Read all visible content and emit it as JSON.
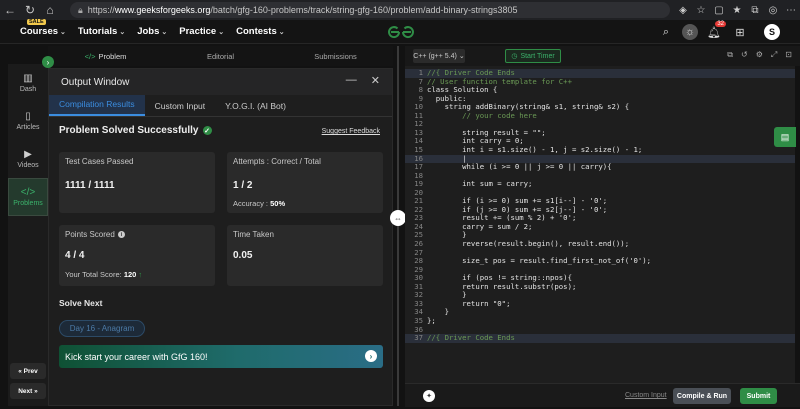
{
  "browser": {
    "url_prefix": "https://",
    "url_domain": "www.geeksforgeeks.org",
    "url_path": "/batch/gfg-160-problems/track/string-gfg-160/problem/add-binary-strings3805"
  },
  "gfgnav": {
    "sale_label": "SALE",
    "items": [
      "Courses",
      "Tutorials",
      "Jobs",
      "Practice",
      "Contests"
    ],
    "logo_text": "GfG",
    "notification_count": "32",
    "avatar_letter": "S"
  },
  "sidebar": {
    "items": [
      {
        "label": "Dash",
        "icon": "▥"
      },
      {
        "label": "Articles",
        "icon": "▯"
      },
      {
        "label": "Videos",
        "icon": "▶"
      },
      {
        "label": "Problems",
        "icon": "</>"
      }
    ],
    "prev_label": "« Prev",
    "next_label": "Next »"
  },
  "problem_tabs": [
    {
      "label": "Problem",
      "icon": "</>"
    },
    {
      "label": "Editorial",
      "icon": ""
    },
    {
      "label": "Submissions",
      "icon": ""
    }
  ],
  "output": {
    "title": "Output Window",
    "tabs": [
      "Compilation Results",
      "Custom Input",
      "Y.O.G.I. (AI Bot)"
    ],
    "status": "Problem Solved Successfully",
    "feedback_link": "Suggest Feedback",
    "test_cases": {
      "label": "Test Cases Passed",
      "value": "1111 / 1111"
    },
    "attempts": {
      "label": "Attempts : Correct / Total",
      "value": "1 / 2",
      "accuracy_label": "Accuracy :",
      "accuracy_value": "50%"
    },
    "points": {
      "label": "Points Scored",
      "value": "4 / 4",
      "total_label": "Your Total Score:",
      "total_value": "120"
    },
    "time": {
      "label": "Time Taken",
      "value": "0.05"
    },
    "solve_next_label": "Solve Next",
    "next_chip": "Day 16 - Anagram",
    "banner_text": "Kick start your career with GfG 160!"
  },
  "editor": {
    "language": "C++ (g++ 5.4)",
    "timer_label": "Start Timer",
    "lines": [
      {
        "n": "1",
        "code": "//{ Driver Code Ends",
        "color": "#6a9955",
        "hl": true
      },
      {
        "n": "7",
        "code": "// User function template for C++",
        "color": "#6a9955"
      },
      {
        "n": "8",
        "code": "class Solution {",
        "color": "#e4e4e4"
      },
      {
        "n": "9",
        "code": "  public:",
        "color": "#e4e4e4"
      },
      {
        "n": "10",
        "code": "    string addBinary(string& s1, string& s2) {",
        "color": "#e4e4e4"
      },
      {
        "n": "11",
        "code": "        // your code here",
        "color": "#6a9955"
      },
      {
        "n": "12",
        "code": "",
        "color": "#e4e4e4"
      },
      {
        "n": "13",
        "code": "        string result = \"\";",
        "color": "#e4e4e4"
      },
      {
        "n": "14",
        "code": "        int carry = 0;",
        "color": "#e4e4e4"
      },
      {
        "n": "15",
        "code": "        int i = s1.size() - 1, j = s2.size() - 1;",
        "color": "#e4e4e4"
      },
      {
        "n": "16",
        "code": "        |",
        "color": "#e4e4e4",
        "hl": true
      },
      {
        "n": "17",
        "code": "        while (i >= 0 || j >= 0 || carry){",
        "color": "#e4e4e4"
      },
      {
        "n": "18",
        "code": "",
        "color": "#e4e4e4"
      },
      {
        "n": "19",
        "code": "        int sum = carry;",
        "color": "#e4e4e4"
      },
      {
        "n": "20",
        "code": "",
        "color": "#e4e4e4"
      },
      {
        "n": "21",
        "code": "        if (i >= 0) sum += s1[i--] - '0';",
        "color": "#e4e4e4"
      },
      {
        "n": "22",
        "code": "        if (j >= 0) sum += s2[j--] - '0';",
        "color": "#e4e4e4"
      },
      {
        "n": "23",
        "code": "        result += (sum % 2) + '0';",
        "color": "#e4e4e4"
      },
      {
        "n": "24",
        "code": "        carry = sum / 2;",
        "color": "#e4e4e4"
      },
      {
        "n": "25",
        "code": "        }",
        "color": "#e4e4e4"
      },
      {
        "n": "26",
        "code": "        reverse(result.begin(), result.end());",
        "color": "#e4e4e4"
      },
      {
        "n": "27",
        "code": "",
        "color": "#e4e4e4"
      },
      {
        "n": "28",
        "code": "        size_t pos = result.find_first_not_of('0');",
        "color": "#e4e4e4"
      },
      {
        "n": "29",
        "code": "",
        "color": "#e4e4e4"
      },
      {
        "n": "30",
        "code": "        if (pos != string::npos){",
        "color": "#e4e4e4"
      },
      {
        "n": "31",
        "code": "        return result.substr(pos);",
        "color": "#e4e4e4"
      },
      {
        "n": "32",
        "code": "        }",
        "color": "#e4e4e4"
      },
      {
        "n": "33",
        "code": "        return \"0\";",
        "color": "#e4e4e4"
      },
      {
        "n": "34",
        "code": "    }",
        "color": "#e4e4e4"
      },
      {
        "n": "35",
        "code": "};",
        "color": "#e4e4e4"
      },
      {
        "n": "36",
        "code": "",
        "color": "#e4e4e4"
      },
      {
        "n": "37",
        "code": "//{ Driver Code Ends",
        "color": "#6a9955",
        "hl": true
      }
    ],
    "custom_input_label": "Custom Input",
    "run_label": "Compile & Run",
    "submit_label": "Submit"
  },
  "colors": {
    "brand_green": "#2f8d46",
    "accent_blue": "#3b8de0"
  }
}
